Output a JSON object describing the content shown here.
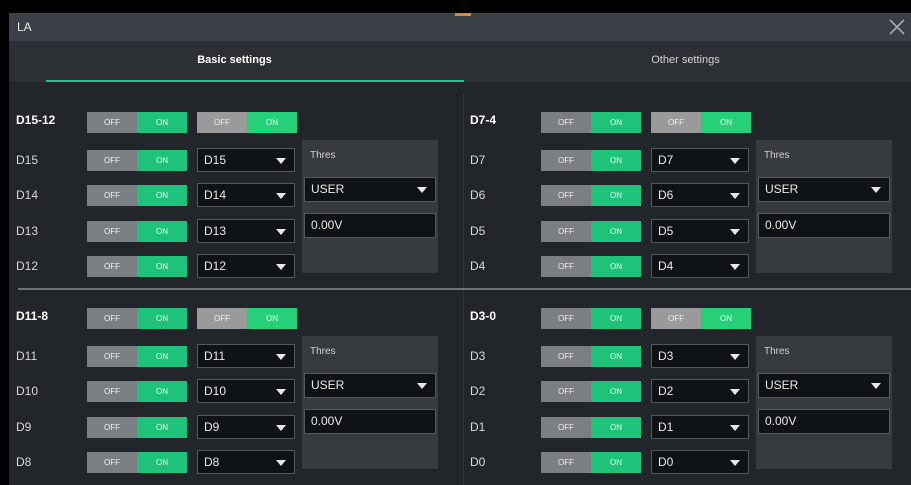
{
  "window": {
    "title": "LA"
  },
  "tabs": {
    "basic": "Basic settings",
    "other": "Other settings"
  },
  "toggle": {
    "off": "OFF",
    "on": "ON"
  },
  "groups": [
    {
      "header": "D15-12",
      "thres_label": "Thres",
      "thres_mode": "USER",
      "thres_value": "0.00V",
      "channels": [
        {
          "label": "D15",
          "select": "D15"
        },
        {
          "label": "D14",
          "select": "D14"
        },
        {
          "label": "D13",
          "select": "D13"
        },
        {
          "label": "D12",
          "select": "D12"
        }
      ]
    },
    {
      "header": "D7-4",
      "thres_label": "Thres",
      "thres_mode": "USER",
      "thres_value": "0.00V",
      "channels": [
        {
          "label": "D7",
          "select": "D7"
        },
        {
          "label": "D6",
          "select": "D6"
        },
        {
          "label": "D5",
          "select": "D5"
        },
        {
          "label": "D4",
          "select": "D4"
        }
      ]
    },
    {
      "header": "D11-8",
      "thres_label": "Thres",
      "thres_mode": "USER",
      "thres_value": "0.00V",
      "channels": [
        {
          "label": "D11",
          "select": "D11"
        },
        {
          "label": "D10",
          "select": "D10"
        },
        {
          "label": "D9",
          "select": "D9"
        },
        {
          "label": "D8",
          "select": "D8"
        }
      ]
    },
    {
      "header": "D3-0",
      "thres_label": "Thres",
      "thres_mode": "USER",
      "thres_value": "0.00V",
      "channels": [
        {
          "label": "D3",
          "select": "D3"
        },
        {
          "label": "D2",
          "select": "D2"
        },
        {
          "label": "D1",
          "select": "D1"
        },
        {
          "label": "D0",
          "select": "D0"
        }
      ]
    }
  ],
  "colors": {
    "on": "#1fc27a",
    "off": "#7b7e82",
    "tab_underline": "#29c28a",
    "title_accent": "#d8902a"
  },
  "icons": {
    "close": "close-icon",
    "dropdown": "chevron-down-icon"
  }
}
